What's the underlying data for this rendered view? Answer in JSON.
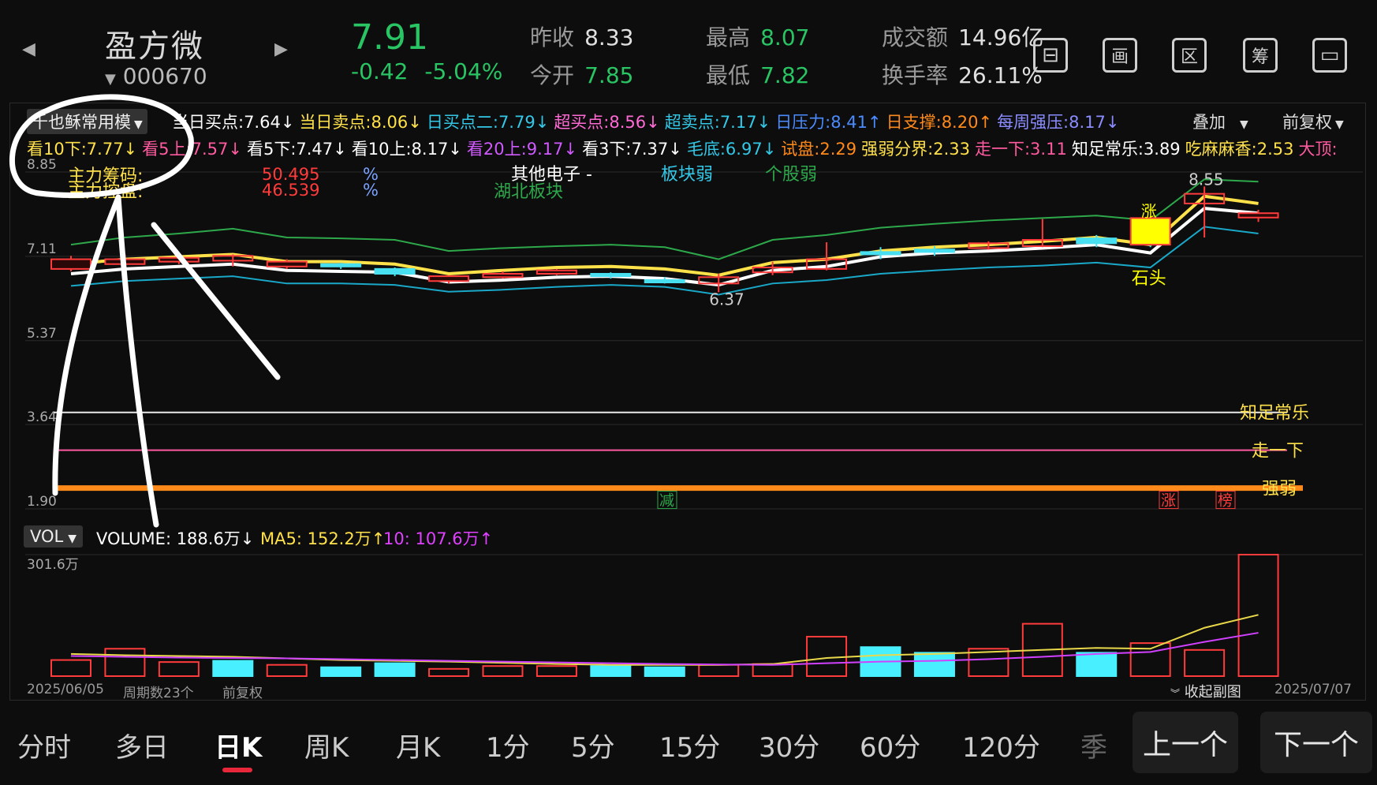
{
  "header": {
    "stock_name": "盈方微",
    "stock_code": "000670",
    "price": "7.91",
    "change": "-0.42",
    "change_pct": "-5.04%",
    "prev_close_label": "昨收",
    "prev_close": "8.33",
    "open_label": "今开",
    "open": "7.85",
    "high_label": "最高",
    "high": "8.07",
    "low_label": "最低",
    "low": "7.82",
    "turnover_label": "成交额",
    "turnover": "14.96亿",
    "turnover_rate_label": "换手率",
    "turnover_rate": "26.11%",
    "tool_icons": [
      "panel-icon",
      "draw-icon",
      "range-icon",
      "chips-icon",
      "multi-window-icon"
    ],
    "tool_glyphs": [
      "⊟",
      "画",
      "区",
      "筹",
      "▭"
    ]
  },
  "indicator_bar": {
    "template_name": "千也稣常用模",
    "overlay_label": "叠加",
    "adjust_label": "前复权",
    "row1": [
      {
        "text": "当日买点:7.64↓",
        "color": "#ffffff"
      },
      {
        "text": "当日卖点:8.06↓",
        "color": "#ffe14a"
      },
      {
        "text": "日买点二:7.79↓",
        "color": "#33c8e8"
      },
      {
        "text": "超买点:8.56↓",
        "color": "#ff6ad5"
      },
      {
        "text": "超卖点:7.17↓",
        "color": "#33c8e8"
      },
      {
        "text": "日压力:8.41↑",
        "color": "#4a8cff"
      },
      {
        "text": "日支撑:8.20↑",
        "color": "#ff8a1a"
      },
      {
        "text": "每周强压:8.17↓",
        "color": "#8a8cff"
      }
    ],
    "row2": [
      {
        "text": "看10下:7.77↓",
        "color": "#ffe14a"
      },
      {
        "text": "看5上:7.57↓",
        "color": "#ff5aa0"
      },
      {
        "text": "看5下:7.47↓",
        "color": "#ffffff"
      },
      {
        "text": "看10上:8.17↓",
        "color": "#ffffff"
      },
      {
        "text": "看20上:9.17↓",
        "color": "#d05aff"
      },
      {
        "text": "看3下:7.37↓",
        "color": "#ffffff"
      },
      {
        "text": "毛底:6.97↓",
        "color": "#33c8e8"
      },
      {
        "text": "试盘:2.29",
        "color": "#ff8a1a"
      },
      {
        "text": "强弱分界:2.33",
        "color": "#ffe14a"
      },
      {
        "text": "走一下:3.11",
        "color": "#ff5aa0"
      },
      {
        "text": "知足常乐:3.89",
        "color": "#ffffff"
      },
      {
        "text": "吃麻麻香:2.53",
        "color": "#ffe14a"
      },
      {
        "text": "大顶:",
        "color": "#ff5aa0"
      }
    ]
  },
  "main_chart": {
    "y_ticks": [
      "8.85",
      "7.11",
      "5.37",
      "3.64",
      "1.90"
    ],
    "chips_label1": "主力筹码:",
    "chips_label2": "主力控盘:",
    "chips_val1": "50.495",
    "chips_val2": "46.539",
    "pct": "%",
    "sector_name": "其他电子 -",
    "sector_region": "湖北板块",
    "sector_weak": "板块弱",
    "stock_weak": "个股弱",
    "peak_label": "8.55",
    "low_label": "6.37",
    "stone_label": "石头",
    "zhang_label": "涨",
    "line_label_zhizu": "知足常乐",
    "line_label_zou": "走一下",
    "line_label_qiang": "强弱",
    "bottom_tag_jian": "减",
    "bottom_tag_zhang": "涨",
    "bottom_tag_bang": "榜"
  },
  "chart_data": {
    "type": "candlestick",
    "ylim": [
      1.9,
      8.85
    ],
    "candles": [
      {
        "o": 7.05,
        "c": 6.85,
        "h": 7.12,
        "l": 6.8,
        "dir": "down"
      },
      {
        "o": 7.05,
        "c": 6.95,
        "h": 7.15,
        "l": 6.9,
        "dir": "down"
      },
      {
        "o": 7.08,
        "c": 7.0,
        "h": 7.12,
        "l": 6.95,
        "dir": "down"
      },
      {
        "o": 7.02,
        "c": 7.12,
        "h": 7.15,
        "l": 6.9,
        "dir": "up"
      },
      {
        "o": 7.0,
        "c": 6.9,
        "h": 7.05,
        "l": 6.85,
        "dir": "down"
      },
      {
        "o": 6.95,
        "c": 6.9,
        "h": 6.98,
        "l": 6.85,
        "dir": "flat"
      },
      {
        "o": 6.85,
        "c": 6.75,
        "h": 6.88,
        "l": 6.7,
        "dir": "flat"
      },
      {
        "o": 6.7,
        "c": 6.6,
        "h": 6.72,
        "l": 6.55,
        "dir": "down"
      },
      {
        "o": 6.75,
        "c": 6.68,
        "h": 6.8,
        "l": 6.65,
        "dir": "down"
      },
      {
        "o": 6.82,
        "c": 6.75,
        "h": 6.85,
        "l": 6.72,
        "dir": "down"
      },
      {
        "o": 6.75,
        "c": 6.72,
        "h": 6.78,
        "l": 6.65,
        "dir": "flat"
      },
      {
        "o": 6.62,
        "c": 6.6,
        "h": 6.68,
        "l": 6.55,
        "dir": "flat"
      },
      {
        "o": 6.55,
        "c": 6.68,
        "h": 6.75,
        "l": 6.37,
        "dir": "up"
      },
      {
        "o": 6.78,
        "c": 6.88,
        "h": 7.0,
        "l": 6.72,
        "dir": "up"
      },
      {
        "o": 7.05,
        "c": 6.85,
        "h": 7.4,
        "l": 6.82,
        "dir": "up"
      },
      {
        "o": 7.15,
        "c": 7.2,
        "h": 7.3,
        "l": 7.05,
        "dir": "flat"
      },
      {
        "o": 7.2,
        "c": 7.25,
        "h": 7.32,
        "l": 7.12,
        "dir": "flat"
      },
      {
        "o": 7.28,
        "c": 7.38,
        "h": 7.42,
        "l": 7.25,
        "dir": "up"
      },
      {
        "o": 7.32,
        "c": 7.45,
        "h": 7.88,
        "l": 7.3,
        "dir": "up"
      },
      {
        "o": 7.48,
        "c": 7.38,
        "h": 7.55,
        "l": 7.3,
        "dir": "flat"
      },
      {
        "o": 7.32,
        "c": 7.6,
        "h": 7.62,
        "l": 7.3,
        "dir": "limit"
      },
      {
        "o": 8.4,
        "c": 8.2,
        "h": 8.55,
        "l": 7.5,
        "dir": "up"
      },
      {
        "o": 8.0,
        "c": 7.91,
        "h": 8.07,
        "l": 7.82,
        "dir": "down"
      }
    ],
    "lines": {
      "green": [
        7.35,
        7.5,
        7.58,
        7.68,
        7.5,
        7.48,
        7.45,
        7.22,
        7.28,
        7.32,
        7.35,
        7.3,
        7.05,
        7.45,
        7.55,
        7.7,
        7.78,
        7.85,
        7.9,
        7.95,
        7.85,
        8.7,
        8.65
      ],
      "yellow": [
        6.95,
        7.05,
        7.1,
        7.15,
        7.0,
        7.0,
        6.95,
        6.75,
        6.82,
        6.88,
        6.9,
        6.85,
        6.72,
        6.98,
        7.05,
        7.22,
        7.3,
        7.35,
        7.42,
        7.5,
        7.35,
        8.35,
        8.2
      ],
      "white": [
        6.75,
        6.85,
        6.9,
        6.95,
        6.82,
        6.8,
        6.78,
        6.58,
        6.62,
        6.68,
        6.7,
        6.65,
        6.52,
        6.82,
        6.9,
        7.1,
        7.18,
        7.22,
        7.28,
        7.35,
        7.18,
        8.1,
        8.0
      ],
      "cyan": [
        6.5,
        6.6,
        6.65,
        6.7,
        6.55,
        6.55,
        6.52,
        6.38,
        6.42,
        6.48,
        6.52,
        6.48,
        6.32,
        6.55,
        6.62,
        6.75,
        6.82,
        6.88,
        6.92,
        6.98,
        6.88,
        7.72,
        7.58
      ]
    },
    "flat_lines": {
      "zhizu": 3.89,
      "zou": 3.11,
      "qiang": 2.33
    }
  },
  "volume_chart": {
    "label": "VOL",
    "volume_text": "VOLUME: 188.6万↓",
    "ma5_text": "MA5: 152.2万↑",
    "ma10_text": "10: 107.6万↑",
    "y_top": "301.6万",
    "date_start": "2025/06/05",
    "period_count": "周期数23个",
    "adjust": "前复权",
    "collapse": "收起副图",
    "date_end": "2025/07/07",
    "ymax": 301.6,
    "vols": [
      40,
      68,
      35,
      38,
      28,
      22,
      32,
      18,
      25,
      25,
      25,
      22,
      28,
      30,
      98,
      72,
      58,
      68,
      130,
      58,
      82,
      65,
      301.6,
      188.6
    ],
    "vol_dirs": [
      "down",
      "down",
      "down",
      "up",
      "down",
      "up",
      "up",
      "down",
      "down",
      "down",
      "up",
      "up",
      "down",
      "down",
      "down",
      "up",
      "up",
      "down",
      "down",
      "up",
      "down",
      "down",
      "down"
    ],
    "ma5": [
      55,
      52,
      50,
      48,
      44,
      40,
      38,
      36,
      33,
      30,
      28,
      28,
      28,
      30,
      45,
      52,
      55,
      60,
      65,
      70,
      68,
      120,
      152.2
    ],
    "ma10": [
      50,
      48,
      46,
      45,
      44,
      42,
      40,
      38,
      36,
      34,
      32,
      30,
      29,
      28,
      32,
      36,
      38,
      42,
      48,
      55,
      60,
      85,
      107.6
    ]
  },
  "timeframes": [
    "分时",
    "多日",
    "日K",
    "周K",
    "月K",
    "1分",
    "5分",
    "15分",
    "30分",
    "60分",
    "120分",
    "季"
  ],
  "active_timeframe": 2,
  "nav": {
    "prev": "上一个",
    "next": "下一个"
  }
}
